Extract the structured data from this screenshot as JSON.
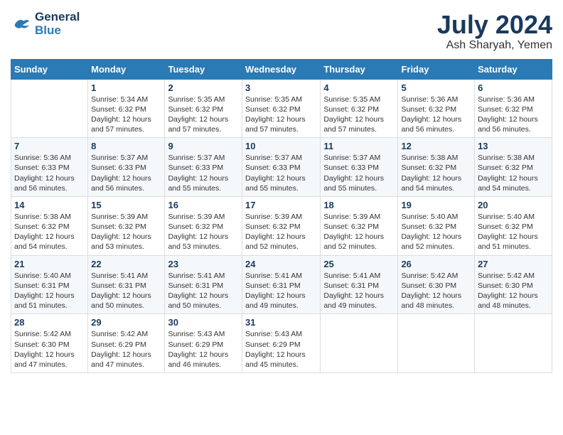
{
  "header": {
    "logo_line1": "General",
    "logo_line2": "Blue",
    "main_title": "July 2024",
    "subtitle": "Ash Sharyah, Yemen"
  },
  "columns": [
    "Sunday",
    "Monday",
    "Tuesday",
    "Wednesday",
    "Thursday",
    "Friday",
    "Saturday"
  ],
  "weeks": [
    [
      {
        "day": "",
        "info": ""
      },
      {
        "day": "1",
        "info": "Sunrise: 5:34 AM\nSunset: 6:32 PM\nDaylight: 12 hours\nand 57 minutes."
      },
      {
        "day": "2",
        "info": "Sunrise: 5:35 AM\nSunset: 6:32 PM\nDaylight: 12 hours\nand 57 minutes."
      },
      {
        "day": "3",
        "info": "Sunrise: 5:35 AM\nSunset: 6:32 PM\nDaylight: 12 hours\nand 57 minutes."
      },
      {
        "day": "4",
        "info": "Sunrise: 5:35 AM\nSunset: 6:32 PM\nDaylight: 12 hours\nand 57 minutes."
      },
      {
        "day": "5",
        "info": "Sunrise: 5:36 AM\nSunset: 6:32 PM\nDaylight: 12 hours\nand 56 minutes."
      },
      {
        "day": "6",
        "info": "Sunrise: 5:36 AM\nSunset: 6:32 PM\nDaylight: 12 hours\nand 56 minutes."
      }
    ],
    [
      {
        "day": "7",
        "info": "Sunrise: 5:36 AM\nSunset: 6:33 PM\nDaylight: 12 hours\nand 56 minutes."
      },
      {
        "day": "8",
        "info": "Sunrise: 5:37 AM\nSunset: 6:33 PM\nDaylight: 12 hours\nand 56 minutes."
      },
      {
        "day": "9",
        "info": "Sunrise: 5:37 AM\nSunset: 6:33 PM\nDaylight: 12 hours\nand 55 minutes."
      },
      {
        "day": "10",
        "info": "Sunrise: 5:37 AM\nSunset: 6:33 PM\nDaylight: 12 hours\nand 55 minutes."
      },
      {
        "day": "11",
        "info": "Sunrise: 5:37 AM\nSunset: 6:33 PM\nDaylight: 12 hours\nand 55 minutes."
      },
      {
        "day": "12",
        "info": "Sunrise: 5:38 AM\nSunset: 6:32 PM\nDaylight: 12 hours\nand 54 minutes."
      },
      {
        "day": "13",
        "info": "Sunrise: 5:38 AM\nSunset: 6:32 PM\nDaylight: 12 hours\nand 54 minutes."
      }
    ],
    [
      {
        "day": "14",
        "info": "Sunrise: 5:38 AM\nSunset: 6:32 PM\nDaylight: 12 hours\nand 54 minutes."
      },
      {
        "day": "15",
        "info": "Sunrise: 5:39 AM\nSunset: 6:32 PM\nDaylight: 12 hours\nand 53 minutes."
      },
      {
        "day": "16",
        "info": "Sunrise: 5:39 AM\nSunset: 6:32 PM\nDaylight: 12 hours\nand 53 minutes."
      },
      {
        "day": "17",
        "info": "Sunrise: 5:39 AM\nSunset: 6:32 PM\nDaylight: 12 hours\nand 52 minutes."
      },
      {
        "day": "18",
        "info": "Sunrise: 5:39 AM\nSunset: 6:32 PM\nDaylight: 12 hours\nand 52 minutes."
      },
      {
        "day": "19",
        "info": "Sunrise: 5:40 AM\nSunset: 6:32 PM\nDaylight: 12 hours\nand 52 minutes."
      },
      {
        "day": "20",
        "info": "Sunrise: 5:40 AM\nSunset: 6:32 PM\nDaylight: 12 hours\nand 51 minutes."
      }
    ],
    [
      {
        "day": "21",
        "info": "Sunrise: 5:40 AM\nSunset: 6:31 PM\nDaylight: 12 hours\nand 51 minutes."
      },
      {
        "day": "22",
        "info": "Sunrise: 5:41 AM\nSunset: 6:31 PM\nDaylight: 12 hours\nand 50 minutes."
      },
      {
        "day": "23",
        "info": "Sunrise: 5:41 AM\nSunset: 6:31 PM\nDaylight: 12 hours\nand 50 minutes."
      },
      {
        "day": "24",
        "info": "Sunrise: 5:41 AM\nSunset: 6:31 PM\nDaylight: 12 hours\nand 49 minutes."
      },
      {
        "day": "25",
        "info": "Sunrise: 5:41 AM\nSunset: 6:31 PM\nDaylight: 12 hours\nand 49 minutes."
      },
      {
        "day": "26",
        "info": "Sunrise: 5:42 AM\nSunset: 6:30 PM\nDaylight: 12 hours\nand 48 minutes."
      },
      {
        "day": "27",
        "info": "Sunrise: 5:42 AM\nSunset: 6:30 PM\nDaylight: 12 hours\nand 48 minutes."
      }
    ],
    [
      {
        "day": "28",
        "info": "Sunrise: 5:42 AM\nSunset: 6:30 PM\nDaylight: 12 hours\nand 47 minutes."
      },
      {
        "day": "29",
        "info": "Sunrise: 5:42 AM\nSunset: 6:29 PM\nDaylight: 12 hours\nand 47 minutes."
      },
      {
        "day": "30",
        "info": "Sunrise: 5:43 AM\nSunset: 6:29 PM\nDaylight: 12 hours\nand 46 minutes."
      },
      {
        "day": "31",
        "info": "Sunrise: 5:43 AM\nSunset: 6:29 PM\nDaylight: 12 hours\nand 45 minutes."
      },
      {
        "day": "",
        "info": ""
      },
      {
        "day": "",
        "info": ""
      },
      {
        "day": "",
        "info": ""
      }
    ]
  ]
}
